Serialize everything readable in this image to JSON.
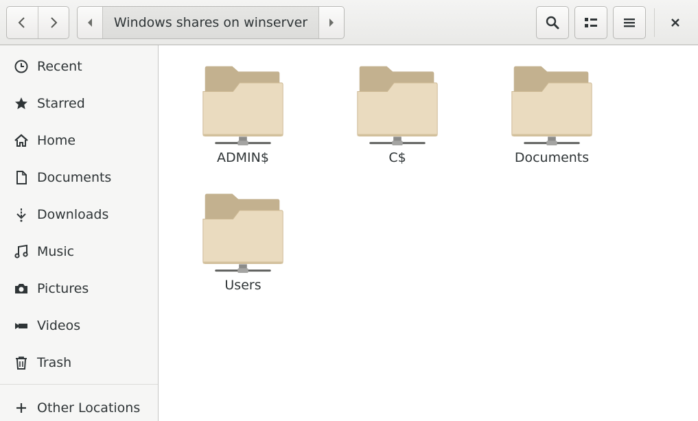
{
  "window": {
    "path_label": "Windows shares on winserver"
  },
  "toolbar": {
    "back_icon": "chevron-left-icon",
    "forward_icon": "chevron-right-icon",
    "path_prev_icon": "triangle-left-icon",
    "path_next_icon": "triangle-right-icon",
    "search_icon": "search-icon",
    "view_icon": "list-view-icon",
    "menu_icon": "hamburger-menu-icon",
    "close_icon": "close-icon"
  },
  "sidebar": {
    "items": [
      {
        "label": "Recent",
        "icon": "clock-icon"
      },
      {
        "label": "Starred",
        "icon": "star-icon"
      },
      {
        "label": "Home",
        "icon": "home-icon"
      },
      {
        "label": "Documents",
        "icon": "document-icon"
      },
      {
        "label": "Downloads",
        "icon": "download-icon"
      },
      {
        "label": "Music",
        "icon": "music-icon"
      },
      {
        "label": "Pictures",
        "icon": "camera-icon"
      },
      {
        "label": "Videos",
        "icon": "video-icon"
      },
      {
        "label": "Trash",
        "icon": "trash-icon"
      },
      {
        "label": "Other Locations",
        "icon": "plus-icon"
      }
    ]
  },
  "shares": [
    {
      "name": "ADMIN$",
      "icon": "network-folder-icon"
    },
    {
      "name": "C$",
      "icon": "network-folder-icon"
    },
    {
      "name": "Documents",
      "icon": "network-folder-icon"
    },
    {
      "name": "Users",
      "icon": "network-folder-icon"
    }
  ],
  "colors": {
    "folder_back": "#c3b18f",
    "folder_front": "#eadbbf",
    "text": "#2e3436"
  }
}
